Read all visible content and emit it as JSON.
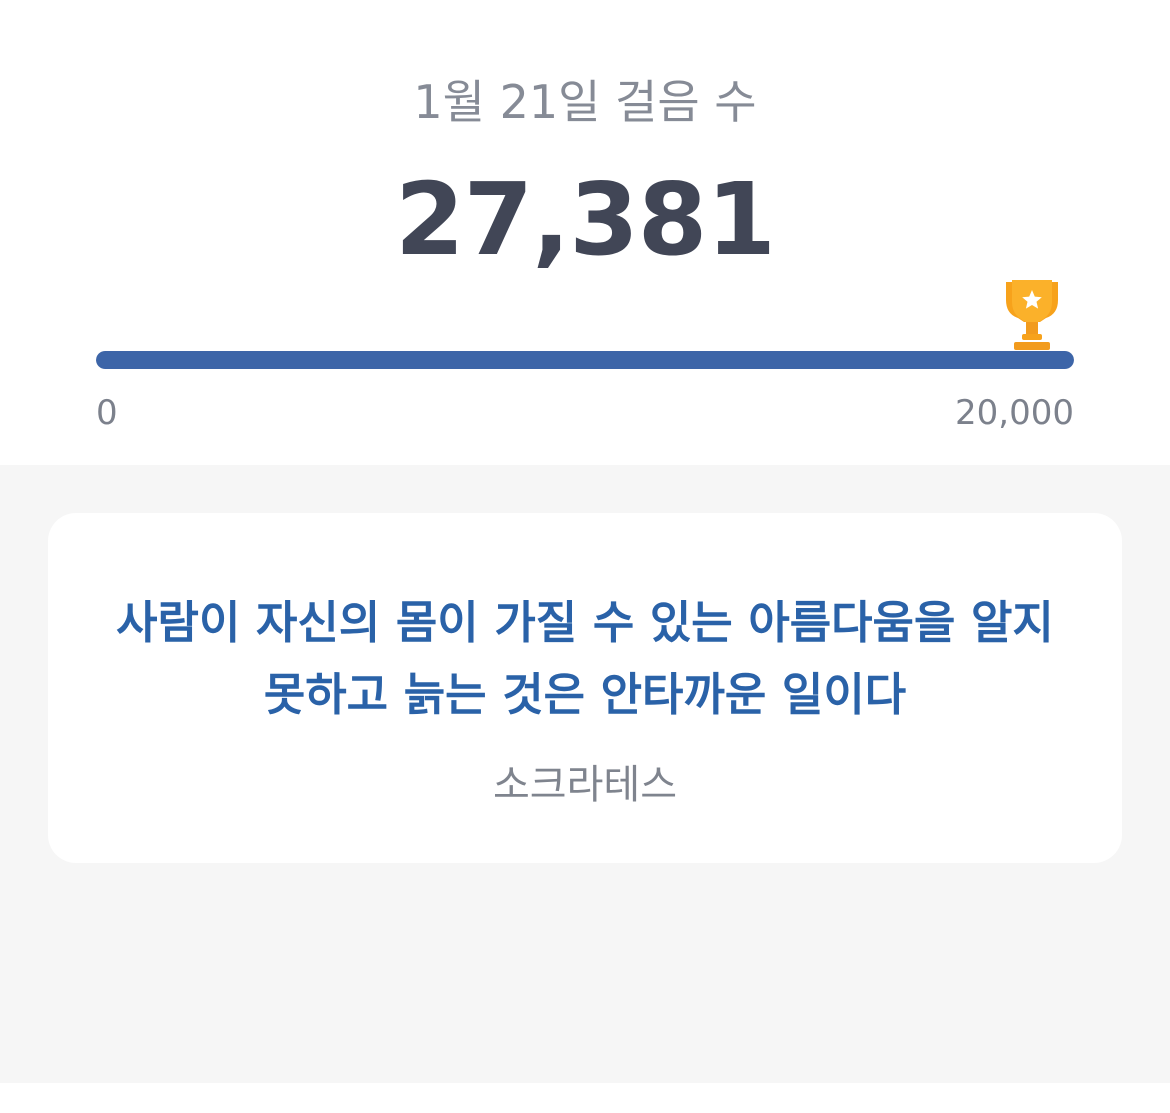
{
  "header": {
    "date_label": "1월 21일 걸음 수",
    "steps": "27,381"
  },
  "progress": {
    "current": 27381,
    "goal": 20000,
    "fill_fraction": 1.0,
    "min_label": "0",
    "max_label": "20,000",
    "goal_icon": "trophy-icon",
    "bar_color": "#3d65a8"
  },
  "quote": {
    "text": "사람이 자신의 몸이 가질 수 있는 아름다움을 알지 못하고 늙는 것은 안타까운 일이다",
    "author": "소크라테스",
    "accent_color": "#2a62a8"
  }
}
